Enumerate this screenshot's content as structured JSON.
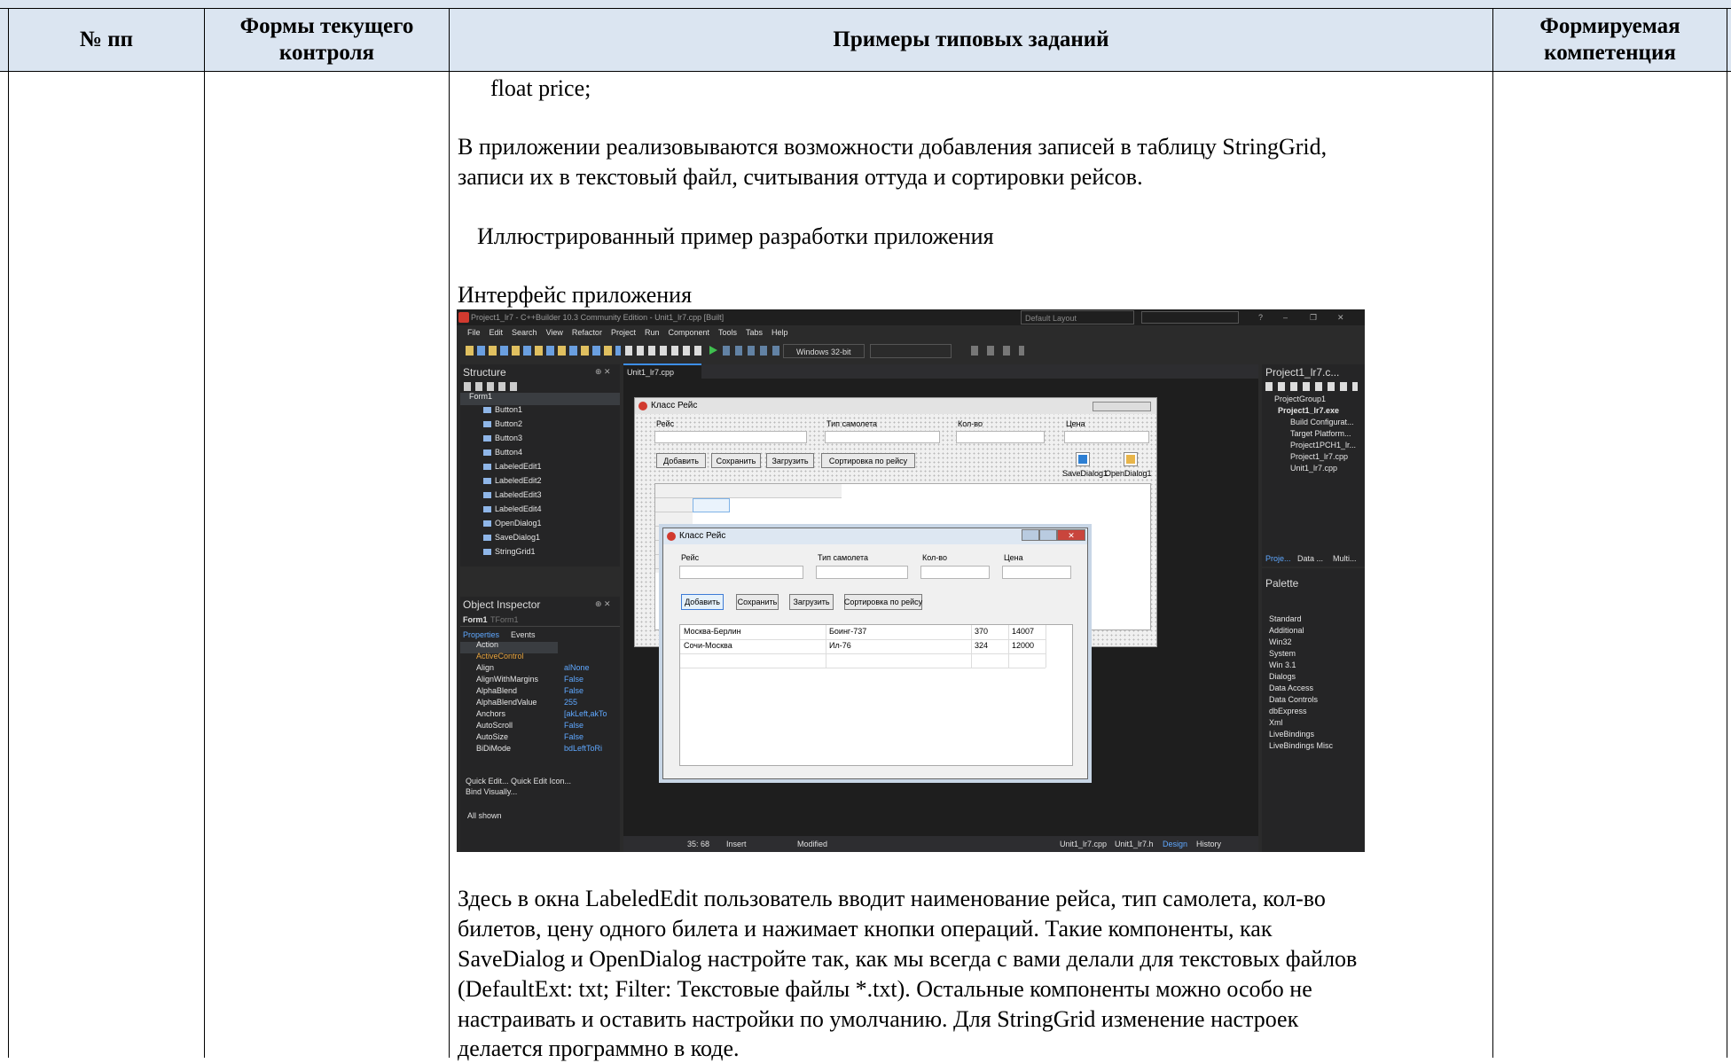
{
  "table": {
    "headers": {
      "col1": "№ пп",
      "col2_line1": "Формы текущего",
      "col2_line2": "контроля",
      "col3": "Примеры типовых заданий",
      "col4_line1": "Формируемая",
      "col4_line2": "компетенция"
    },
    "body": {
      "code_line": "float price;",
      "p1_line1": "В приложении реализовываются возможности добавления записей в таблицу StringGrid,",
      "p1_line2": "записи их в текстовый файл, считывания оттуда и сортировки рейсов.",
      "p2": "Иллюстрированный пример разработки приложения",
      "p3": "Интерфейс приложения",
      "p4_lines": [
        "Здесь в окна LabeledEdit пользователь вводит наименование рейса, тип самолета, кол-во",
        "билетов, цену одного билета и нажимает кнопки операций. Такие компоненты, как",
        "SaveDialog и OpenDialog настройте так, как мы всегда с вами делали для текстовых файлов",
        "(DefaultExt: txt; Filter: Текстовые файлы *.txt). Остальные компоненты можно особо не",
        "настраивать и оставить настройки по умолчанию. Для StringGrid изменение настроек",
        "делается программно в коде."
      ]
    }
  },
  "ide": {
    "title": "Project1_lr7 - C++Builder 10.3 Community Edition - Unit1_lr7.cpp [Built]",
    "layout": "Default Layout",
    "menu": [
      "File",
      "Edit",
      "Search",
      "View",
      "Refactor",
      "Project",
      "Run",
      "Component",
      "Tools",
      "Tabs",
      "Help"
    ],
    "platform": "Windows 32-bit",
    "editor_tab": "Unit1_lr7.cpp",
    "structure": {
      "title": "Structure",
      "root": "Form1",
      "items": [
        "Button1",
        "Button2",
        "Button3",
        "Button4",
        "LabeledEdit1",
        "LabeledEdit2",
        "LabeledEdit3",
        "LabeledEdit4",
        "OpenDialog1",
        "SaveDialog1",
        "StringGrid1"
      ]
    },
    "object_inspector": {
      "title": "Object Inspector",
      "selected": "Form1",
      "selected_type": "TForm1",
      "tabs": [
        "Properties",
        "Events"
      ],
      "rows": [
        {
          "name": "Action",
          "value": ""
        },
        {
          "name": "ActiveControl",
          "value": ""
        },
        {
          "name": "Align",
          "value": "alNone"
        },
        {
          "name": "AlignWithMargins",
          "value": "False"
        },
        {
          "name": "AlphaBlend",
          "value": "False"
        },
        {
          "name": "AlphaBlendValue",
          "value": "255"
        },
        {
          "name": "Anchors",
          "value": "[akLeft,akTo"
        },
        {
          "name": "AutoScroll",
          "value": "False"
        },
        {
          "name": "AutoSize",
          "value": "False"
        },
        {
          "name": "BiDiMode",
          "value": "bdLeftToRi"
        }
      ],
      "footer1": "Quick Edit...  Quick Edit Icon...",
      "footer2": "Bind Visually...",
      "status": "All shown"
    },
    "designer_form": {
      "caption": "Класс Рейс",
      "labels": [
        "Рейс",
        "Тип самолета",
        "Кол-во",
        "Цена"
      ],
      "buttons": [
        "Добавить",
        "Сохранить",
        "Загрузить",
        "Сортировка по рейсу"
      ],
      "dialogs": [
        "SaveDialog1",
        "OpenDialog1"
      ]
    },
    "running_form": {
      "caption": "Класс Рейс",
      "labels": [
        "Рейс",
        "Тип самолета",
        "Кол-во",
        "Цена"
      ],
      "buttons": [
        "Добавить",
        "Сохранить",
        "Загрузить",
        "Сортировка по рейсу"
      ],
      "rows": [
        [
          "Москва-Берлин",
          "Боинг-737",
          "370",
          "14007"
        ],
        [
          "Сочи-Москва",
          "Ил-76",
          "324",
          "12000"
        ]
      ]
    },
    "project": {
      "title": "Project1_lr7.c...",
      "items": [
        "ProjectGroup1",
        "Project1_lr7.exe",
        "Build Configurat...",
        "Target Platform...",
        "Project1PCH1_lr...",
        "Project1_lr7.cpp",
        "Unit1_lr7.cpp"
      ],
      "tabs": [
        "Proje...",
        "Data ...",
        "Multi..."
      ]
    },
    "palette": {
      "title": "Palette",
      "items": [
        "Standard",
        "Additional",
        "Win32",
        "System",
        "Win 3.1",
        "Dialogs",
        "Data Access",
        "Data Controls",
        "dbExpress",
        "Xml",
        "LiveBindings",
        "LiveBindings Misc"
      ]
    },
    "statusbar": {
      "position": "35: 68",
      "mode": "Insert",
      "state": "Modified",
      "tabs": [
        "Unit1_lr7.cpp",
        "Unit1_lr7.h",
        "Design",
        "History"
      ]
    }
  }
}
